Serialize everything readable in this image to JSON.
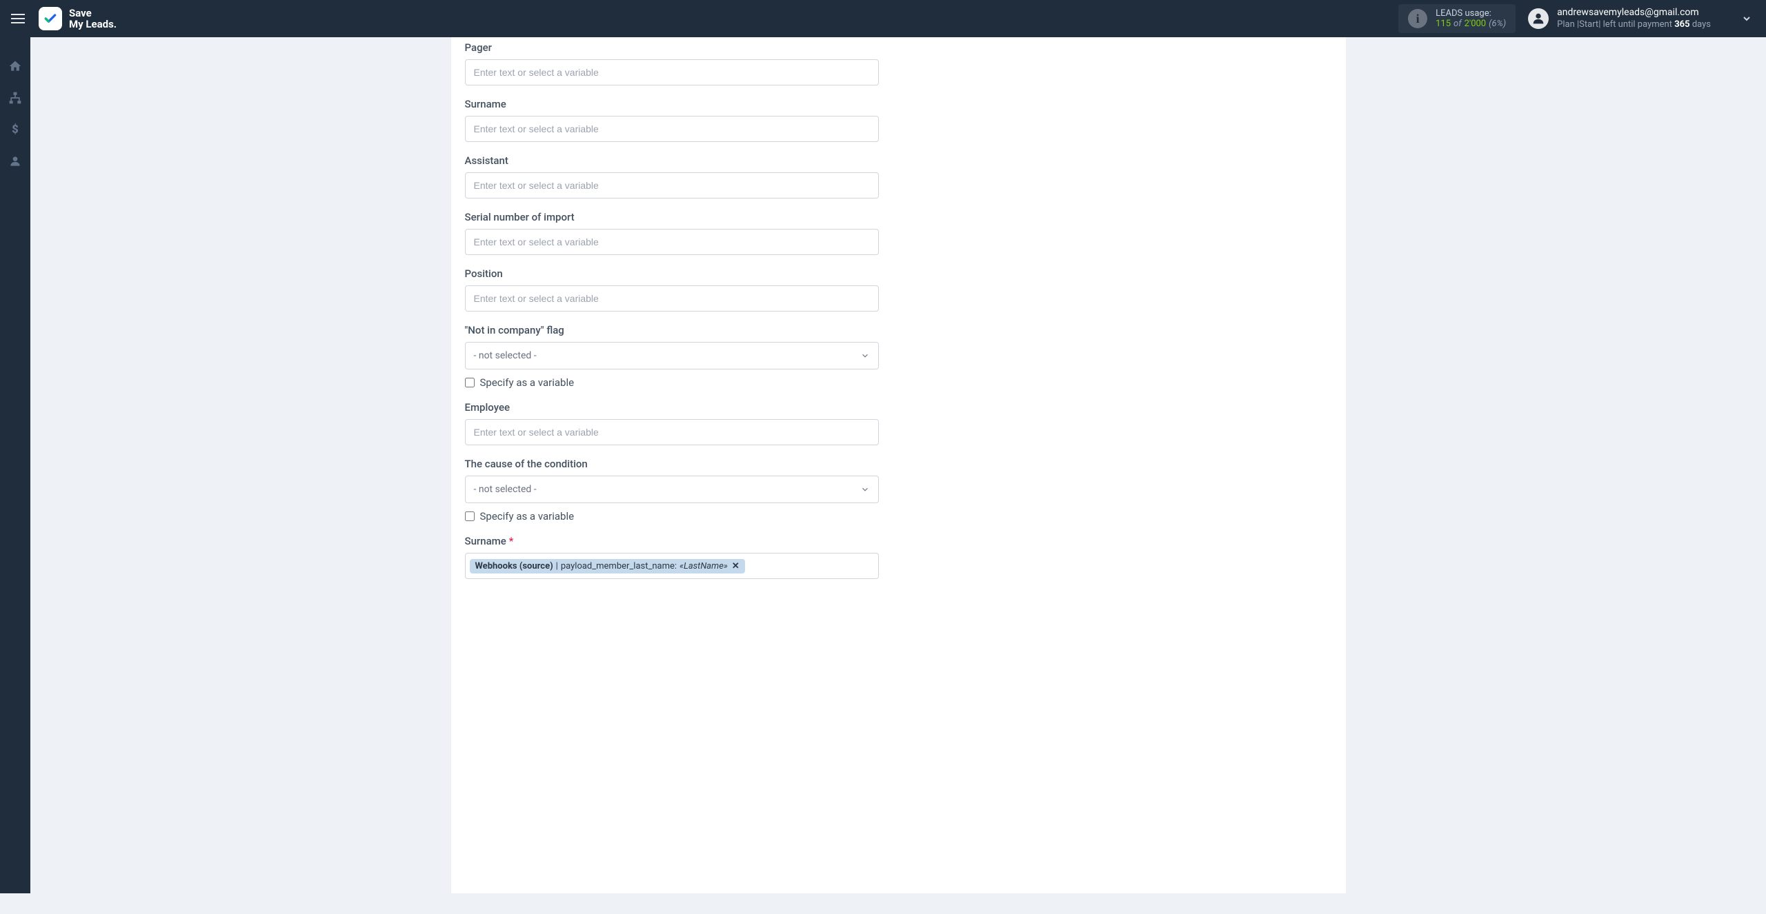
{
  "logo": {
    "line1": "Save",
    "line2": "My Leads."
  },
  "leads_usage": {
    "label": "LEADS usage:",
    "current": "115",
    "of": "of",
    "total": "2'000",
    "percent": "(6%)"
  },
  "user": {
    "email": "andrewsavemyleads@gmail.com",
    "plan_prefix": "Plan |",
    "plan_name": "Start",
    "plan_sep": "|",
    "payment_text": "left until payment",
    "days_count": "365",
    "days_suffix": "days"
  },
  "form": {
    "placeholder": "Enter text or select a variable",
    "not_selected": "- not selected -",
    "specify_variable": "Specify as a variable",
    "fields": {
      "pager": "Pager",
      "surname": "Surname",
      "assistant": "Assistant",
      "serial": "Serial number of import",
      "position": "Position",
      "not_in_company": "\"Not in company\" flag",
      "employee": "Employee",
      "cause": "The cause of the condition",
      "surname_req": "Surname"
    },
    "token": {
      "source": "Webhooks (source)",
      "sep": " | ",
      "field": "payload_member_last_name: ",
      "value": "«LastName»"
    }
  }
}
